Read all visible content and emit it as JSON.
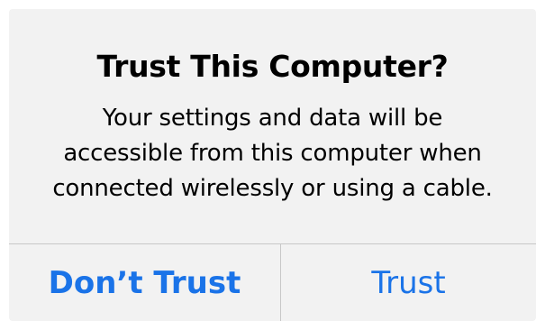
{
  "alert": {
    "title": "Trust This Computer?",
    "message_lines": [
      "Your settings and data will be",
      "accessible from this computer when",
      "connected wirelessly or using a cable."
    ],
    "buttons": {
      "dont_trust": "Don’t Trust",
      "trust": "Trust"
    }
  },
  "colors": {
    "accent": "#1a73e8",
    "alert_background": "#f2f2f2",
    "divider": "#c8c8c8",
    "text": "#000000"
  }
}
